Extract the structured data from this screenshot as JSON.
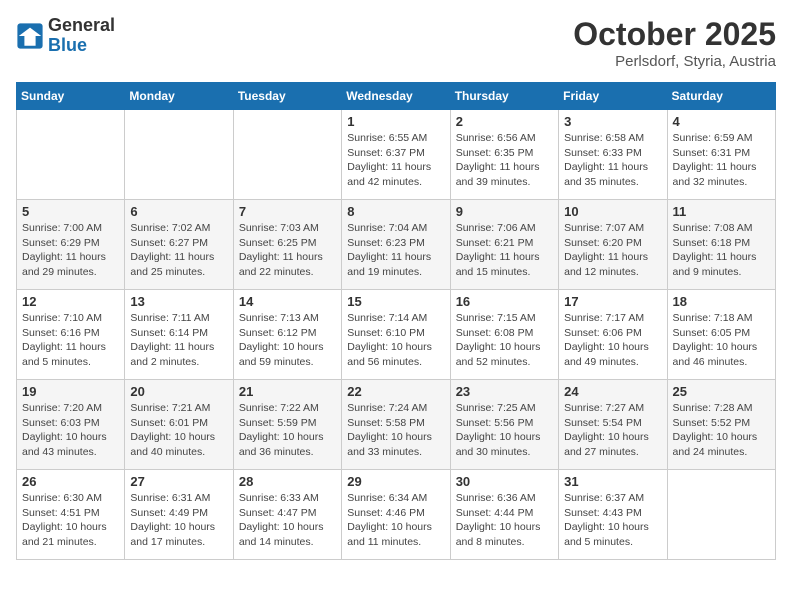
{
  "header": {
    "logo_general": "General",
    "logo_blue": "Blue",
    "month_title": "October 2025",
    "month_subtitle": "Perlsdorf, Styria, Austria"
  },
  "weekdays": [
    "Sunday",
    "Monday",
    "Tuesday",
    "Wednesday",
    "Thursday",
    "Friday",
    "Saturday"
  ],
  "weeks": [
    [
      {
        "day": "",
        "info": ""
      },
      {
        "day": "",
        "info": ""
      },
      {
        "day": "",
        "info": ""
      },
      {
        "day": "1",
        "info": "Sunrise: 6:55 AM\nSunset: 6:37 PM\nDaylight: 11 hours\nand 42 minutes."
      },
      {
        "day": "2",
        "info": "Sunrise: 6:56 AM\nSunset: 6:35 PM\nDaylight: 11 hours\nand 39 minutes."
      },
      {
        "day": "3",
        "info": "Sunrise: 6:58 AM\nSunset: 6:33 PM\nDaylight: 11 hours\nand 35 minutes."
      },
      {
        "day": "4",
        "info": "Sunrise: 6:59 AM\nSunset: 6:31 PM\nDaylight: 11 hours\nand 32 minutes."
      }
    ],
    [
      {
        "day": "5",
        "info": "Sunrise: 7:00 AM\nSunset: 6:29 PM\nDaylight: 11 hours\nand 29 minutes."
      },
      {
        "day": "6",
        "info": "Sunrise: 7:02 AM\nSunset: 6:27 PM\nDaylight: 11 hours\nand 25 minutes."
      },
      {
        "day": "7",
        "info": "Sunrise: 7:03 AM\nSunset: 6:25 PM\nDaylight: 11 hours\nand 22 minutes."
      },
      {
        "day": "8",
        "info": "Sunrise: 7:04 AM\nSunset: 6:23 PM\nDaylight: 11 hours\nand 19 minutes."
      },
      {
        "day": "9",
        "info": "Sunrise: 7:06 AM\nSunset: 6:21 PM\nDaylight: 11 hours\nand 15 minutes."
      },
      {
        "day": "10",
        "info": "Sunrise: 7:07 AM\nSunset: 6:20 PM\nDaylight: 11 hours\nand 12 minutes."
      },
      {
        "day": "11",
        "info": "Sunrise: 7:08 AM\nSunset: 6:18 PM\nDaylight: 11 hours\nand 9 minutes."
      }
    ],
    [
      {
        "day": "12",
        "info": "Sunrise: 7:10 AM\nSunset: 6:16 PM\nDaylight: 11 hours\nand 5 minutes."
      },
      {
        "day": "13",
        "info": "Sunrise: 7:11 AM\nSunset: 6:14 PM\nDaylight: 11 hours\nand 2 minutes."
      },
      {
        "day": "14",
        "info": "Sunrise: 7:13 AM\nSunset: 6:12 PM\nDaylight: 10 hours\nand 59 minutes."
      },
      {
        "day": "15",
        "info": "Sunrise: 7:14 AM\nSunset: 6:10 PM\nDaylight: 10 hours\nand 56 minutes."
      },
      {
        "day": "16",
        "info": "Sunrise: 7:15 AM\nSunset: 6:08 PM\nDaylight: 10 hours\nand 52 minutes."
      },
      {
        "day": "17",
        "info": "Sunrise: 7:17 AM\nSunset: 6:06 PM\nDaylight: 10 hours\nand 49 minutes."
      },
      {
        "day": "18",
        "info": "Sunrise: 7:18 AM\nSunset: 6:05 PM\nDaylight: 10 hours\nand 46 minutes."
      }
    ],
    [
      {
        "day": "19",
        "info": "Sunrise: 7:20 AM\nSunset: 6:03 PM\nDaylight: 10 hours\nand 43 minutes."
      },
      {
        "day": "20",
        "info": "Sunrise: 7:21 AM\nSunset: 6:01 PM\nDaylight: 10 hours\nand 40 minutes."
      },
      {
        "day": "21",
        "info": "Sunrise: 7:22 AM\nSunset: 5:59 PM\nDaylight: 10 hours\nand 36 minutes."
      },
      {
        "day": "22",
        "info": "Sunrise: 7:24 AM\nSunset: 5:58 PM\nDaylight: 10 hours\nand 33 minutes."
      },
      {
        "day": "23",
        "info": "Sunrise: 7:25 AM\nSunset: 5:56 PM\nDaylight: 10 hours\nand 30 minutes."
      },
      {
        "day": "24",
        "info": "Sunrise: 7:27 AM\nSunset: 5:54 PM\nDaylight: 10 hours\nand 27 minutes."
      },
      {
        "day": "25",
        "info": "Sunrise: 7:28 AM\nSunset: 5:52 PM\nDaylight: 10 hours\nand 24 minutes."
      }
    ],
    [
      {
        "day": "26",
        "info": "Sunrise: 6:30 AM\nSunset: 4:51 PM\nDaylight: 10 hours\nand 21 minutes."
      },
      {
        "day": "27",
        "info": "Sunrise: 6:31 AM\nSunset: 4:49 PM\nDaylight: 10 hours\nand 17 minutes."
      },
      {
        "day": "28",
        "info": "Sunrise: 6:33 AM\nSunset: 4:47 PM\nDaylight: 10 hours\nand 14 minutes."
      },
      {
        "day": "29",
        "info": "Sunrise: 6:34 AM\nSunset: 4:46 PM\nDaylight: 10 hours\nand 11 minutes."
      },
      {
        "day": "30",
        "info": "Sunrise: 6:36 AM\nSunset: 4:44 PM\nDaylight: 10 hours\nand 8 minutes."
      },
      {
        "day": "31",
        "info": "Sunrise: 6:37 AM\nSunset: 4:43 PM\nDaylight: 10 hours\nand 5 minutes."
      },
      {
        "day": "",
        "info": ""
      }
    ]
  ]
}
